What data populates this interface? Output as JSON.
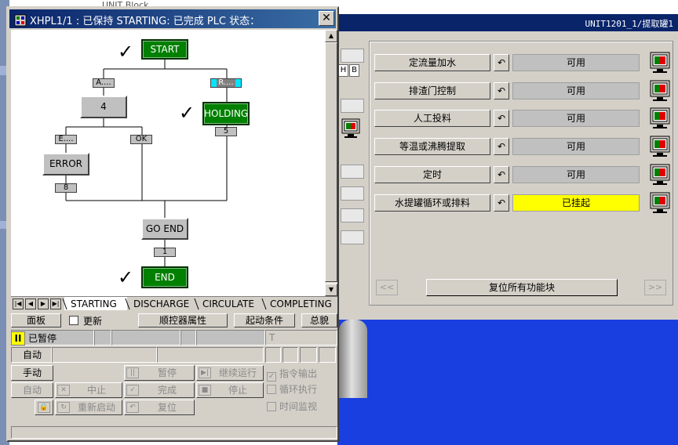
{
  "background": {
    "crumb": "UNIT Block",
    "title": "UNIT1201_1/提取罐1",
    "hb_labels": [
      "H",
      "B"
    ],
    "functions": [
      {
        "label": "定流量加水",
        "status": "可用",
        "highlight": false
      },
      {
        "label": "排渣门控制",
        "status": "可用",
        "highlight": false
      },
      {
        "label": "人工投料",
        "status": "可用",
        "highlight": false
      },
      {
        "label": "等温或沸腾提取",
        "status": "可用",
        "highlight": false
      },
      {
        "label": "定时",
        "status": "可用",
        "highlight": false
      },
      {
        "label": "水提罐循环或排料",
        "status": "已挂起",
        "highlight": true
      }
    ],
    "prev_label": "<<",
    "next_label": ">>",
    "reset_all_label": "复位所有功能块",
    "highlight_color": "#ffff00"
  },
  "dialog": {
    "title": "XHPL1/1 : 已保持 STARTING: 已完成    PLC 状态：",
    "close_label": "✕",
    "sfc": {
      "steps": {
        "start": "START",
        "s4": "4",
        "holding": "HOLDING",
        "error": "ERROR",
        "goend": "GO END",
        "end": "END"
      },
      "transitions": {
        "a": "A....",
        "r": "R....",
        "t5": "5",
        "e": "E....",
        "ok": "OK",
        "t8": "8",
        "t1": "1"
      },
      "check_mark": "✓"
    },
    "tabs": [
      "STARTING",
      "DISCHARGE",
      "CIRCULATE",
      "COMPLETING"
    ],
    "tab_nav": [
      "|◀",
      "◀",
      "▶",
      "▶|"
    ],
    "toolbar": {
      "panel": "面板",
      "update": "更新",
      "sequencer_props": "顺控器属性",
      "start_condition": "起动条件",
      "overview": "总貌"
    },
    "status": {
      "pause_glyph": "II",
      "state_text": "已暂停",
      "field_t": "T"
    },
    "controls": {
      "auto_label": "自动",
      "manual_label": "手动",
      "auto2_label": "自动",
      "pause": "暂停",
      "resume": "继续运行",
      "abort": "中止",
      "complete": "完成",
      "stop": "停止",
      "restart": "重新启动",
      "reset": "复位",
      "cmd_output": "指令输出",
      "cyclic_exec": "循环执行",
      "time_monitor": "时间监视"
    }
  }
}
